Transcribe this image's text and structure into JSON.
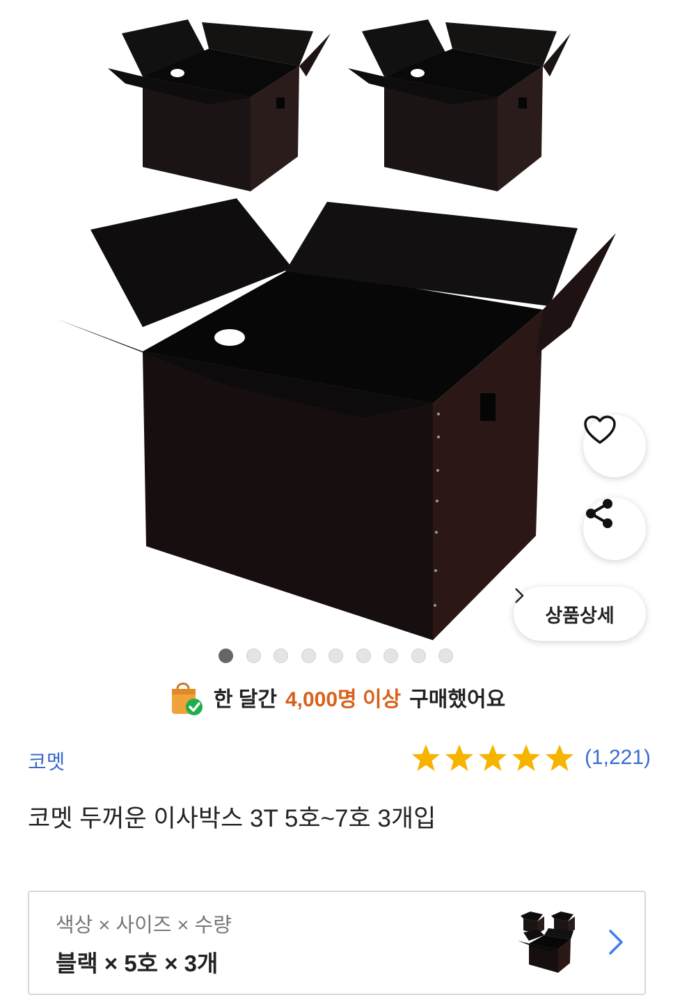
{
  "gallery": {
    "image_alt": "black moving boxes",
    "slide_count": 9,
    "active_slide": 1
  },
  "actions": {
    "detail_label": "상품상세"
  },
  "social_proof": {
    "prefix": "한 달간",
    "highlight": "4,000명 이상",
    "suffix": "구매했어요"
  },
  "product": {
    "brand": "코멧",
    "rating_stars": 5,
    "review_count": "(1,221)",
    "title": "코멧 두꺼운 이사박스 3T 5호~7호 3개입"
  },
  "option": {
    "label": "색상 × 사이즈 × 수량",
    "value": "블랙 × 5호 × 3개"
  },
  "colors": {
    "brand_link": "#3b6bd1",
    "highlight": "#d9601a",
    "star": "#f6b400",
    "chevron": "#3b7cf0"
  }
}
